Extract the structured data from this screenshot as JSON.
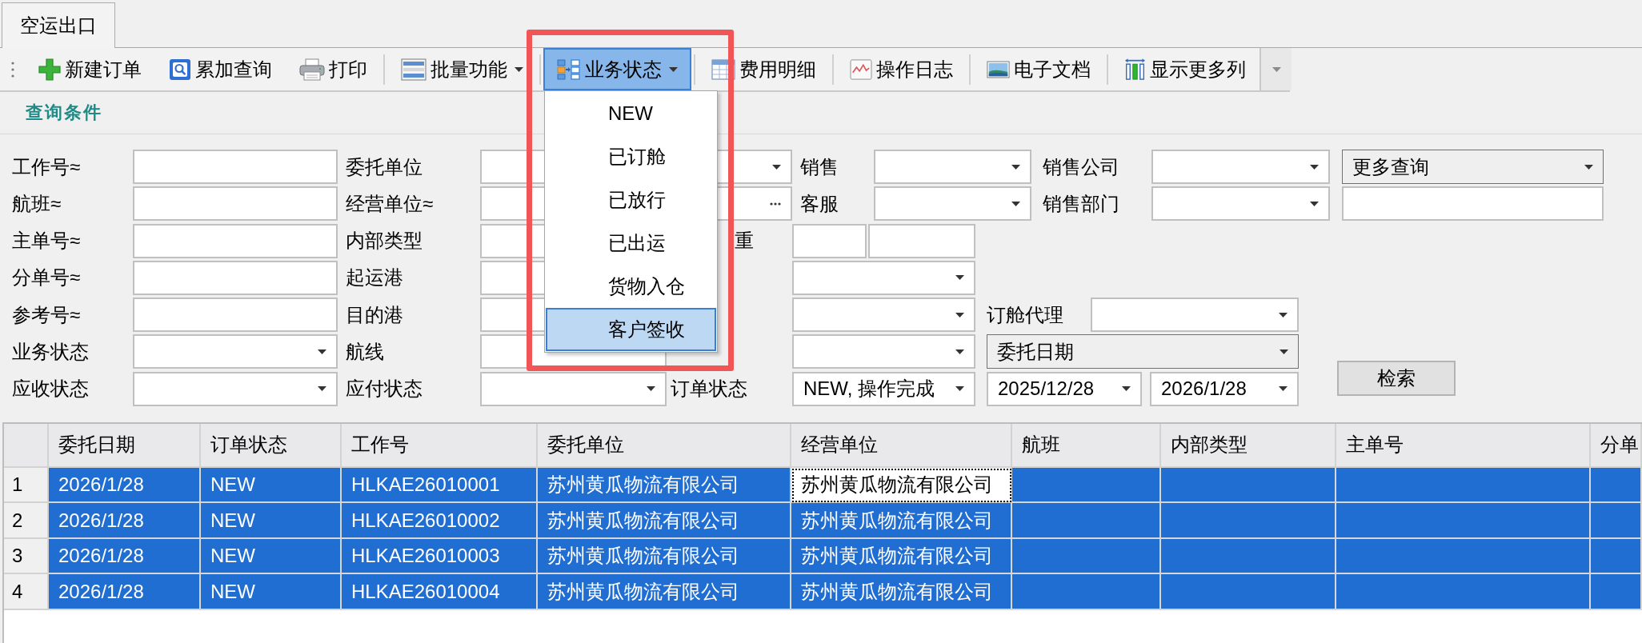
{
  "tabs": [
    {
      "label": "空运出口",
      "selected": true
    }
  ],
  "toolbar": {
    "groups": [
      [
        {
          "label": "新建订单",
          "dropdown": false,
          "pressed": false
        },
        {
          "label": "累加查询",
          "dropdown": false,
          "pressed": false
        },
        {
          "label": "打印",
          "dropdown": false,
          "pressed": false
        }
      ],
      [
        {
          "label": "批量功能",
          "dropdown": true,
          "pressed": false
        }
      ],
      [
        {
          "label": "业务状态",
          "dropdown": true,
          "pressed": true,
          "menu": [
            {
              "label": "NEW",
              "selected": false
            },
            {
              "label": "已订舱",
              "selected": false
            },
            {
              "label": "已放行",
              "selected": false
            },
            {
              "label": "已出运",
              "selected": false
            },
            {
              "label": "货物入仓",
              "selected": false
            },
            {
              "label": "客户签收",
              "selected": true
            }
          ]
        }
      ],
      [
        {
          "label": "费用明细",
          "dropdown": false,
          "pressed": false
        }
      ],
      [
        {
          "label": "操作日志",
          "dropdown": false,
          "pressed": false
        }
      ],
      [
        {
          "label": "电子文档",
          "dropdown": false,
          "pressed": false
        }
      ],
      [
        {
          "label": "显示更多列",
          "dropdown": false,
          "pressed": false
        }
      ]
    ]
  },
  "query_panel": {
    "title": "查询条件",
    "fields": [
      {
        "label": "工作号≈",
        "kind": "text"
      },
      {
        "label": "委托单位",
        "kind": "combo"
      },
      {
        "label": "销售",
        "kind": "combo"
      },
      {
        "label": "销售公司",
        "kind": "combo"
      },
      {
        "kind": "list",
        "value": "更多查询"
      },
      {
        "label": "航班≈",
        "kind": "text"
      },
      {
        "label": "经营单位≈",
        "kind": "picker"
      },
      {
        "label": "客服",
        "kind": "combo"
      },
      {
        "label": "销售部门",
        "kind": "combo"
      },
      {
        "kind": "text"
      },
      {
        "label": "主单号≈",
        "kind": "text"
      },
      {
        "label": "内部类型",
        "kind": "text"
      },
      {
        "label": "重",
        "kind": "range"
      },
      {
        "label": "分单号≈",
        "kind": "text"
      },
      {
        "label": "起运港",
        "kind": "text"
      },
      {
        "kind": "combo"
      },
      {
        "label": "参考号≈",
        "kind": "text"
      },
      {
        "label": "目的港",
        "kind": "text"
      },
      {
        "kind": "combo"
      },
      {
        "label": "订舱代理",
        "kind": "combo"
      },
      {
        "label": "业务状态",
        "kind": "combo"
      },
      {
        "label": "航线",
        "kind": "text"
      },
      {
        "kind": "combo"
      },
      {
        "kind": "list",
        "value": "委托日期"
      },
      {
        "label": "应收状态",
        "kind": "combo"
      },
      {
        "label": "应付状态",
        "kind": "combo"
      },
      {
        "label": "订单状态",
        "kind": "combo",
        "value": "NEW, 操作完成"
      },
      {
        "kind": "combo",
        "value": "2025/12/28"
      },
      {
        "kind": "combo",
        "value": "2026/1/28"
      },
      {
        "kind": "button",
        "value": "检索"
      }
    ]
  },
  "table": {
    "columns": [
      "委托日期",
      "订单状态",
      "工作号",
      "委托单位",
      "经营单位",
      "航班",
      "内部类型",
      "主单号",
      "分单"
    ],
    "rows": [
      {
        "number": "1",
        "selected": true,
        "cells": [
          {
            "text": "2026/1/28",
            "focused": false
          },
          {
            "text": "NEW",
            "focused": false
          },
          {
            "text": "HLKAE26010001",
            "focused": false
          },
          {
            "text": "苏州黄瓜物流有限公司",
            "focused": false
          },
          {
            "text": "苏州黄瓜物流有限公司",
            "focused": true
          }
        ]
      },
      {
        "number": "2",
        "selected": true,
        "cells": [
          {
            "text": "2026/1/28",
            "focused": false
          },
          {
            "text": "NEW",
            "focused": false
          },
          {
            "text": "HLKAE26010002",
            "focused": false
          },
          {
            "text": "苏州黄瓜物流有限公司",
            "focused": false
          },
          {
            "text": "苏州黄瓜物流有限公司",
            "focused": false
          }
        ]
      },
      {
        "number": "3",
        "selected": true,
        "cells": [
          {
            "text": "2026/1/28",
            "focused": false
          },
          {
            "text": "NEW",
            "focused": false
          },
          {
            "text": "HLKAE26010003",
            "focused": false
          },
          {
            "text": "苏州黄瓜物流有限公司",
            "focused": false
          },
          {
            "text": "苏州黄瓜物流有限公司",
            "focused": false
          }
        ]
      },
      {
        "number": "4",
        "selected": true,
        "cells": [
          {
            "text": "2026/1/28",
            "focused": false
          },
          {
            "text": "NEW",
            "focused": false
          },
          {
            "text": "HLKAE26010004",
            "focused": false
          },
          {
            "text": "苏州黄瓜物流有限公司",
            "focused": false
          },
          {
            "text": "苏州黄瓜物流有限公司",
            "focused": false
          }
        ]
      }
    ]
  }
}
